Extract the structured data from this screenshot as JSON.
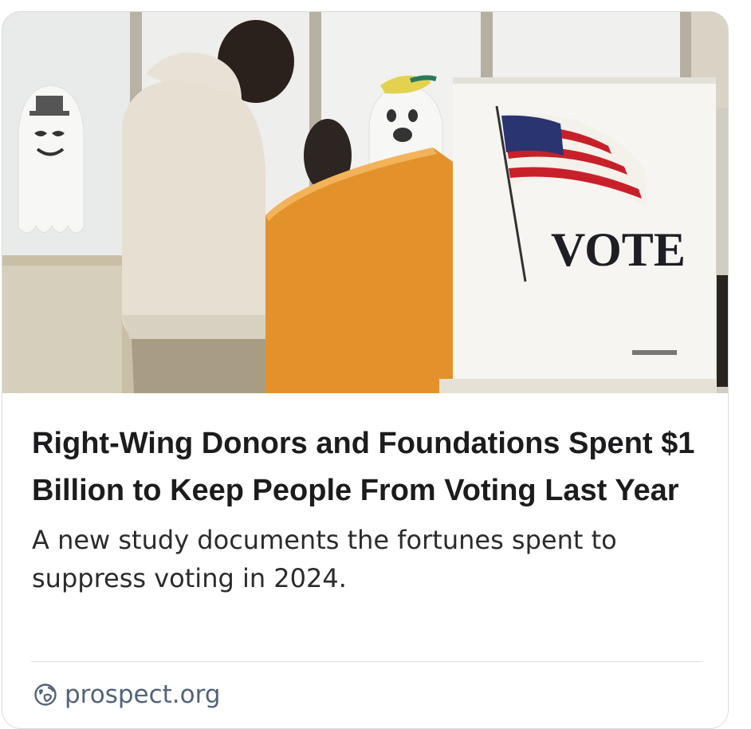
{
  "image": {
    "alt": "Voter standing at an orange voting booth next to a white booth with an American flag and the word VOTE",
    "booth_text": "VOTE",
    "colors": {
      "booth_orange": "#e3922b",
      "flag_red": "#c8202a",
      "flag_blue": "#2a3470"
    }
  },
  "article": {
    "headline": "Right-Wing Donors and Foundations Spent $1 Billion to Keep People From Voting Last Year",
    "description": "A new study documents the fortunes spent to suppress voting in 2024."
  },
  "source": {
    "icon": "globe-icon",
    "domain": "prospect.org",
    "color": "#52637a"
  }
}
